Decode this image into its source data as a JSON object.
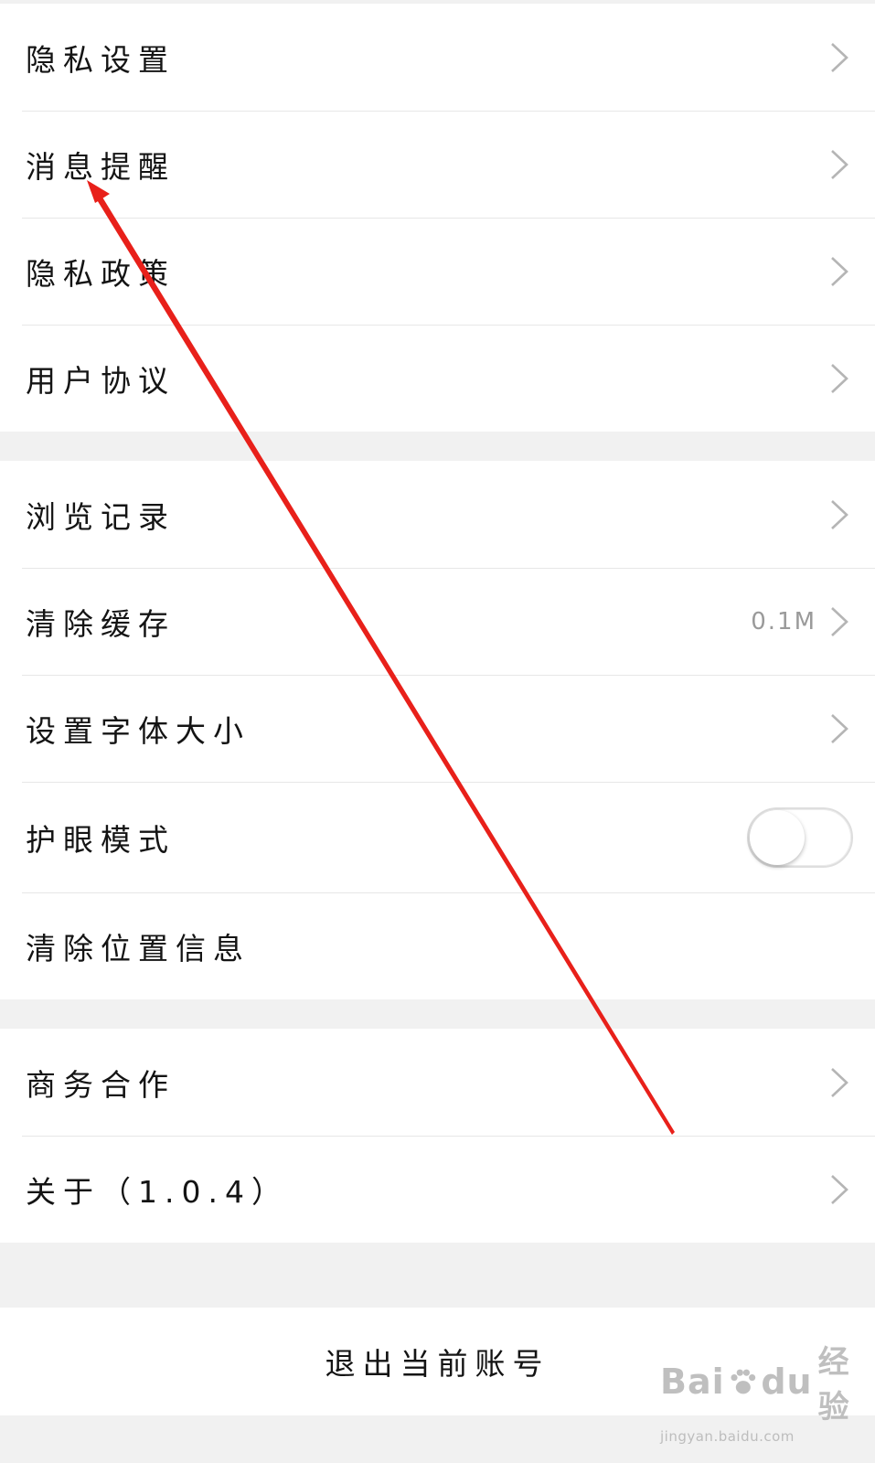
{
  "section1": [
    {
      "label": "隐私设置"
    },
    {
      "label": "消息提醒"
    },
    {
      "label": "隐私政策"
    },
    {
      "label": "用户协议"
    }
  ],
  "section2": [
    {
      "label": "浏览记录"
    },
    {
      "label": "清除缓存",
      "value": "0.1M"
    },
    {
      "label": "设置字体大小"
    },
    {
      "label": "护眼模式",
      "toggle": false
    },
    {
      "label": "清除位置信息"
    }
  ],
  "section3": [
    {
      "label": "商务合作"
    },
    {
      "label": "关于（1.0.4）"
    }
  ],
  "logout_label": "退出当前账号",
  "watermark": {
    "brand_left": "Bai",
    "brand_right": "du",
    "brand_cn": "经验",
    "url": "jingyan.baidu.com"
  },
  "colors": {
    "annotation_arrow": "#e8201a",
    "divider": "#e7e7e7",
    "background": "#f1f1f1"
  },
  "icons": [
    "chevron-right-icon",
    "toggle-switch",
    "paw-icon"
  ]
}
